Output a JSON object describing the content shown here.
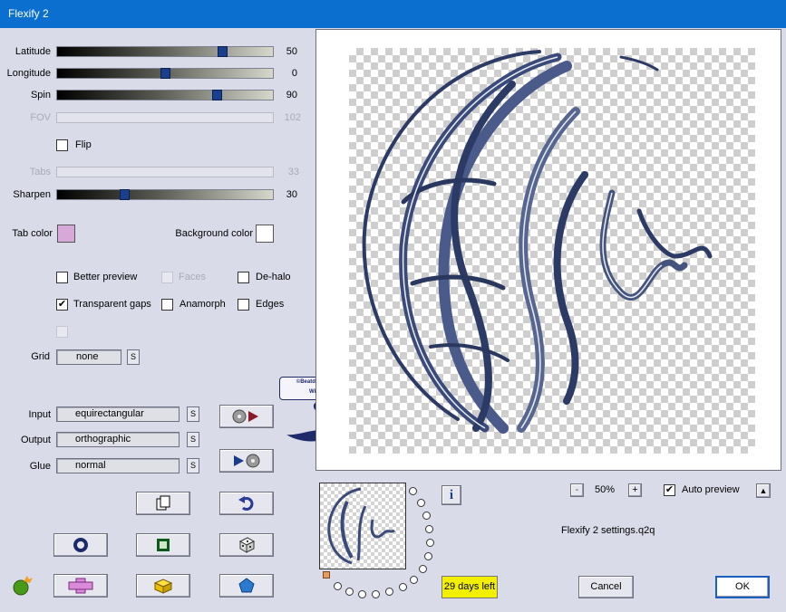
{
  "window": {
    "title": "Flexify 2"
  },
  "sliders": {
    "latitude": {
      "label": "Latitude",
      "value": "50"
    },
    "longitude": {
      "label": "Longitude",
      "value": "0"
    },
    "spin": {
      "label": "Spin",
      "value": "90"
    },
    "fov": {
      "label": "FOV",
      "value": "102"
    },
    "tabs": {
      "label": "Tabs",
      "value": "33"
    },
    "sharpen": {
      "label": "Sharpen",
      "value": "30"
    }
  },
  "checkboxes": {
    "flip": "Flip",
    "better_preview": "Better preview",
    "faces": "Faces",
    "de_halo": "De-halo",
    "transparent_gaps": "Transparent gaps",
    "anamorph": "Anamorph",
    "edges": "Edges"
  },
  "colors": {
    "tab_color_label": "Tab color",
    "tab_color_value": "#d8a8d8",
    "background_color_label": "Background color",
    "background_color_value": "#ffffff"
  },
  "grid": {
    "label": "Grid",
    "value": "none",
    "s": "S"
  },
  "projection": {
    "input_label": "Input",
    "input_value": "equirectangular",
    "output_label": "Output",
    "output_value": "orthographic",
    "glue_label": "Glue",
    "glue_value": "normal",
    "s": "S"
  },
  "zoom": {
    "minus": "-",
    "value": "50%",
    "plus": "+"
  },
  "auto_preview": "Auto preview",
  "settings_file": "Flexify 2 settings.q2q",
  "trial": "29 days left",
  "buttons": {
    "cancel": "Cancel",
    "ok": "OK",
    "info": "i",
    "collapse": "▲"
  },
  "watermark": {
    "line1": "©Beatdigitaion",
    "line2": "Wisa"
  }
}
